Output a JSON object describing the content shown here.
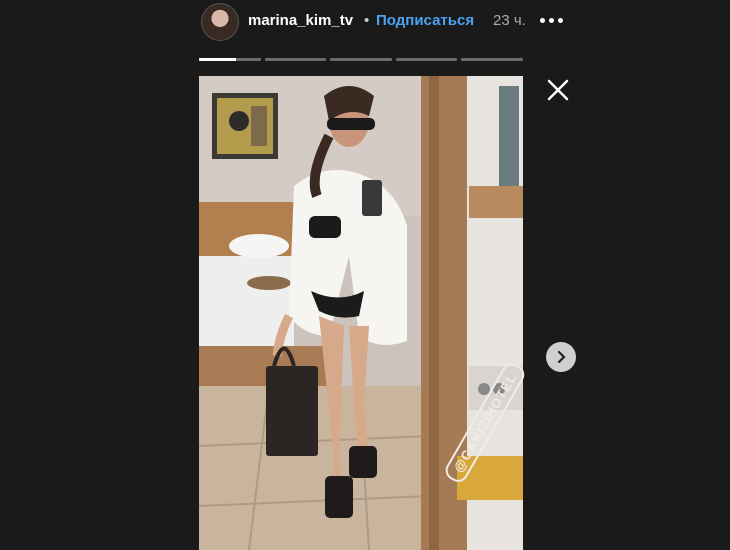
{
  "header": {
    "username": "marina_kim_tv",
    "separator": "•",
    "subscribe_label": "Подписаться",
    "time": "23 ч."
  },
  "story": {
    "segments": 5,
    "active_segment": 1,
    "active_progress": 0.6,
    "watermark": "@CAKIZIHOTEL"
  },
  "icons": {
    "close": "close-icon",
    "next": "chevron-right-icon",
    "more": "more-horizontal-icon"
  },
  "colors": {
    "background": "#1a1a1a",
    "link": "#4aa3f0"
  }
}
